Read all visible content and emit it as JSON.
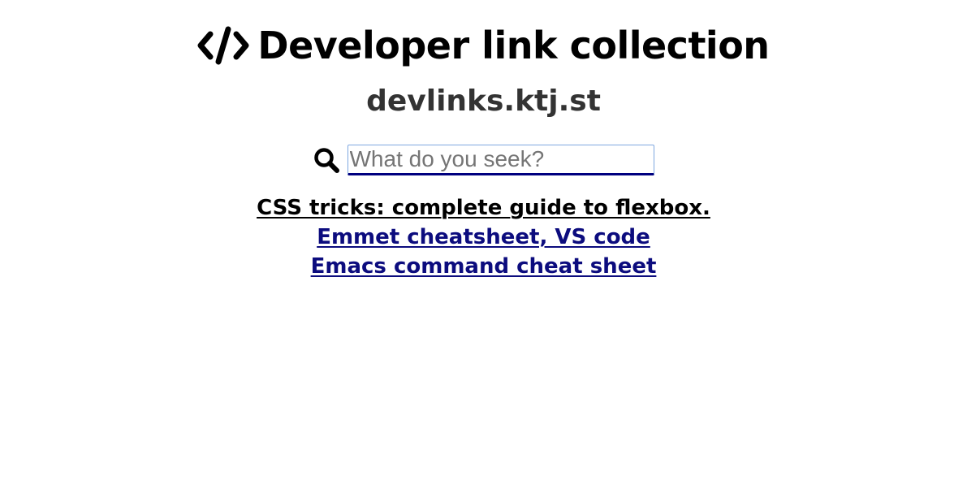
{
  "header": {
    "logo_icon": "code-brackets-icon",
    "title": "Developer link collection",
    "subtitle": "devlinks.ktj.st"
  },
  "search": {
    "icon": "search-icon",
    "placeholder": "What do you seek?",
    "value": ""
  },
  "links": [
    {
      "label": "CSS tricks: complete guide to flexbox.",
      "state": "visited",
      "color": "#000000"
    },
    {
      "label": "Emmet cheatsheet, VS code",
      "state": "unvisited",
      "color": "#0c0c7e"
    },
    {
      "label": "Emacs command cheat sheet",
      "state": "unvisited",
      "color": "#0c0c7e"
    }
  ]
}
